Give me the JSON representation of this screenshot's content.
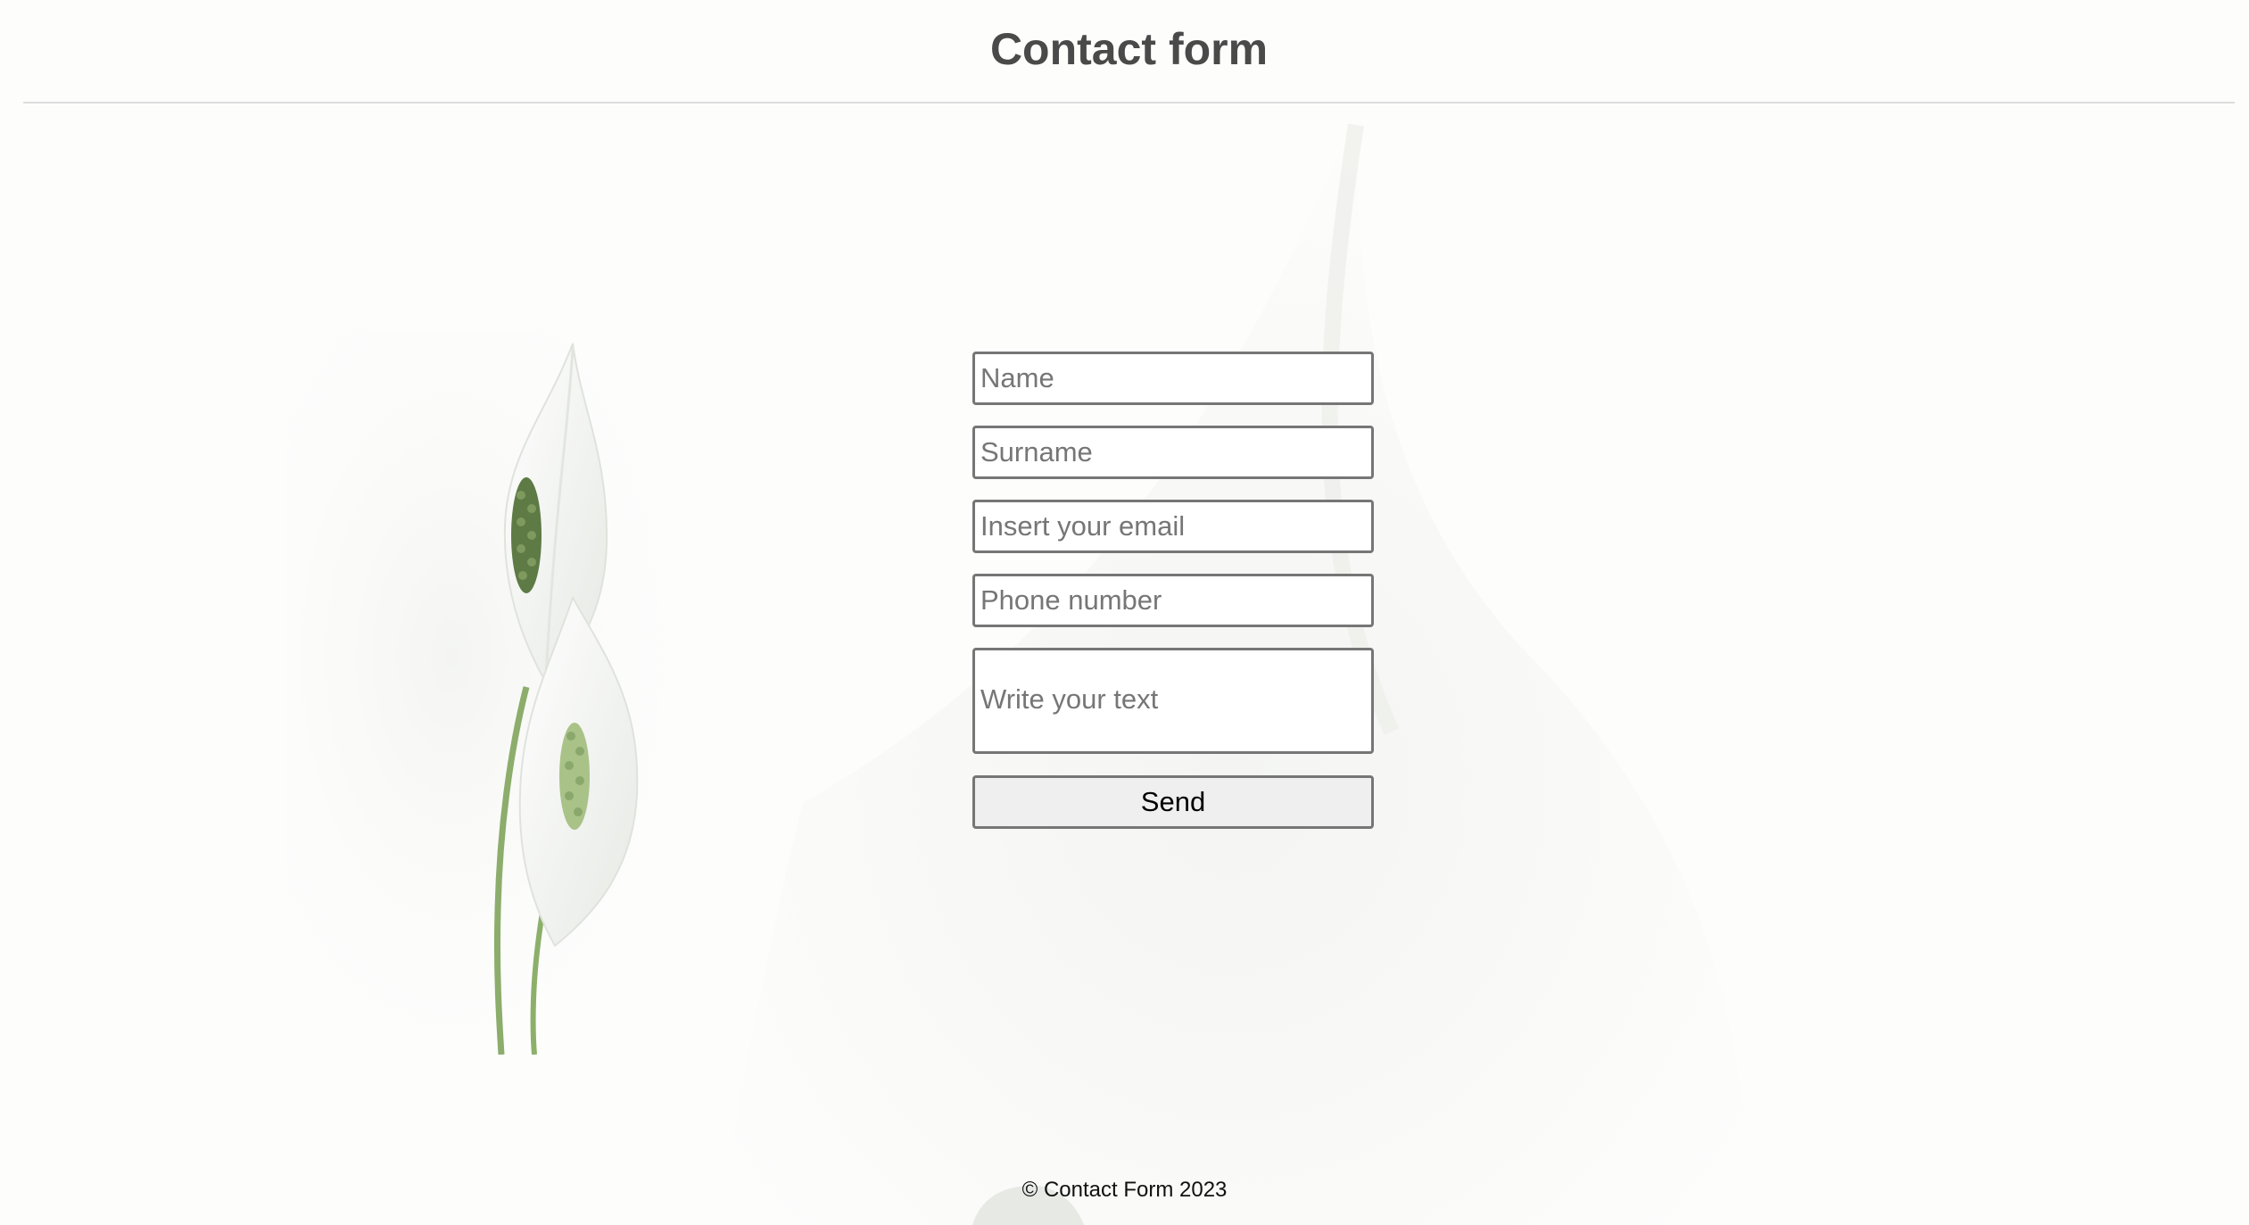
{
  "header": {
    "title": "Contact form"
  },
  "form": {
    "name_placeholder": "Name",
    "surname_placeholder": "Surname",
    "email_placeholder": "Insert your email",
    "phone_placeholder": "Phone number",
    "message_placeholder": "Write your text",
    "send_label": "Send"
  },
  "footer": {
    "copyright": "© Contact Form 2023"
  },
  "decor": {
    "plant_image": "peace-lily-illustration",
    "background_image": "faded-lily-background"
  }
}
